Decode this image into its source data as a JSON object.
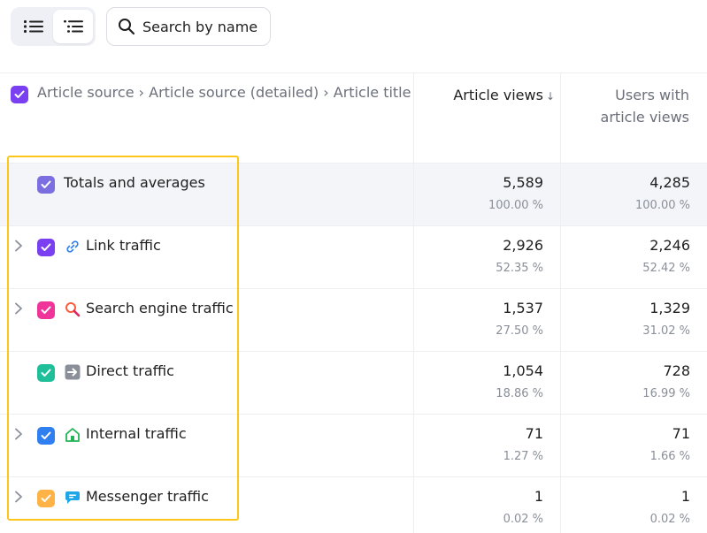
{
  "toolbar": {
    "view_list_icon": "list-icon",
    "view_tree_icon": "tree-list-icon",
    "search": {
      "placeholder": "Search by name",
      "icon": "search-icon"
    }
  },
  "table": {
    "header": {
      "dimensions": "Article source › Article source (detailed) › Article title",
      "metric1": "Article views",
      "metric1_sort": "↓",
      "metric2_line1": "Users with",
      "metric2_line2": "article views"
    },
    "rows": [
      {
        "label": "Totals and averages",
        "views": "5,589",
        "views_pct": "100.00 %",
        "users": "4,285",
        "users_pct": "100.00 %",
        "color": "#7b6ee0"
      },
      {
        "label": "Link traffic",
        "views": "2,926",
        "views_pct": "52.35 %",
        "users": "2,246",
        "users_pct": "52.42 %",
        "color": "#7a3ff0",
        "icon": "link-icon"
      },
      {
        "label": "Search engine traffic",
        "views": "1,537",
        "views_pct": "27.50 %",
        "users": "1,329",
        "users_pct": "31.02 %",
        "color": "#f0359a",
        "icon": "magnifier-icon"
      },
      {
        "label": "Direct traffic",
        "views": "1,054",
        "views_pct": "18.86 %",
        "users": "728",
        "users_pct": "16.99 %",
        "color": "#1fbf9a",
        "icon": "arrow-right-icon"
      },
      {
        "label": "Internal traffic",
        "views": "71",
        "views_pct": "1.27 %",
        "users": "71",
        "users_pct": "1.66 %",
        "color": "#2f7ff0",
        "icon": "home-icon"
      },
      {
        "label": "Messenger traffic",
        "views": "1",
        "views_pct": "0.02 %",
        "users": "1",
        "users_pct": "0.02 %",
        "color": "#ffb347",
        "icon": "chat-icon"
      }
    ]
  },
  "colors": {
    "accent": "#7a3ff0",
    "highlight": "#ffc61a"
  }
}
